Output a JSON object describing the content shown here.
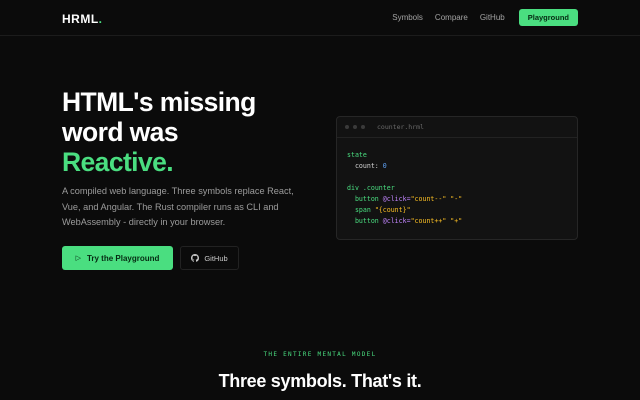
{
  "nav": {
    "logo": "HRML",
    "logo_dot": ".",
    "links": [
      "Symbols",
      "Compare",
      "GitHub"
    ],
    "cta": "Playground"
  },
  "hero": {
    "title_line1": "HTML's missing",
    "title_line2": "word was",
    "title_accent": "Reactive.",
    "description": "A compiled web language. Three symbols replace React, Vue, and Angular. The Rust compiler runs as CLI and WebAssembly - directly in your browser.",
    "primary_button": "Try the Playground",
    "secondary_button": "GitHub"
  },
  "editor": {
    "filename": "counter.hrml",
    "code": {
      "state_kw": "state",
      "count_key": "count:",
      "count_val": "0",
      "div_kw": "div",
      "div_class": ".counter",
      "btn1_kw": "button",
      "btn1_attr": "@click=",
      "btn1_val": "\"count--\"",
      "btn1_text": "\"-\"",
      "span_kw": "span",
      "span_text": "\"{count}\"",
      "btn2_kw": "button",
      "btn2_attr": "@click=",
      "btn2_val": "\"count++\"",
      "btn2_text": "\"+\""
    }
  },
  "section": {
    "kicker": "THE ENTIRE MENTAL MODEL",
    "title": "Three symbols. That's it."
  },
  "colors": {
    "accent": "#4ade80",
    "background": "#0b0b0b"
  }
}
